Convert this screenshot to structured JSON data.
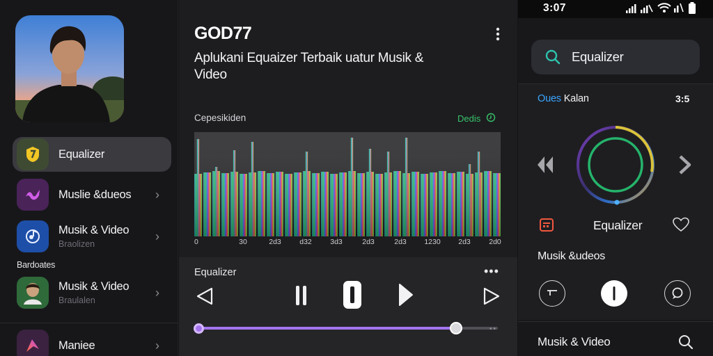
{
  "sidebar": {
    "items": [
      {
        "label": "Equalizer",
        "sub": "",
        "active": true,
        "icon": "equalizer-badge-icon"
      },
      {
        "label": "Muslie &dueos",
        "sub": "",
        "active": false,
        "icon": "music-wave-icon"
      },
      {
        "label": "Musik & Video",
        "sub": "Braolizen",
        "active": false,
        "icon": "globe-music-icon"
      },
      {
        "label": "Musik & Video",
        "sub": "Braulalen",
        "active": false,
        "icon": "artist-thumbnail"
      },
      {
        "label": "Maniee",
        "sub": "",
        "active": false,
        "icon": "app-logo-icon"
      }
    ],
    "section_label": "Bardoates"
  },
  "center": {
    "title": "GOD77",
    "subtitle": "Aplukani Equaizer Terbaik uatur Musik & Video",
    "spectrum_label": "Cepesikiden",
    "spectrum_right": "Dedis",
    "x_labels": [
      "0",
      "30",
      "2d3",
      "d32",
      "3d3",
      "2d3",
      "2d3",
      "1230",
      "2d3",
      "2d0"
    ],
    "player": {
      "title": "Equalizer",
      "progress": 0.86
    }
  },
  "right": {
    "status_time": "3:07",
    "search_text": "Equalizer",
    "card_head_highlight": "Oues",
    "card_head_rest": " Kalan",
    "card_head_right": "3:5",
    "eq_label": "Equalizer",
    "section_label": "Musik &udeos",
    "bottom_title": "Musik & Video"
  },
  "colors": {
    "accent_purple": "#a474ee",
    "accent_green": "#38c46a",
    "accent_blue": "#3aa6ff",
    "ring_green": "#25b46b"
  }
}
